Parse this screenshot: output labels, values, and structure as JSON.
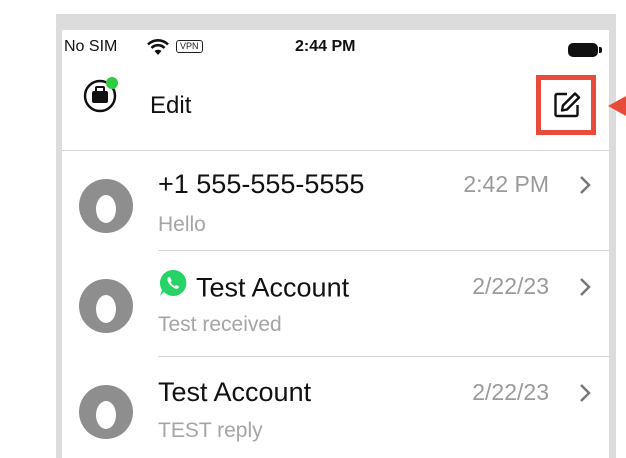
{
  "status_bar": {
    "carrier": "No SIM",
    "vpn": "VPN",
    "time": "2:44 PM"
  },
  "nav": {
    "edit_label": "Edit"
  },
  "conversations": [
    {
      "name": "+1 555-555-5555",
      "preview": "Hello",
      "time": "2:42 PM",
      "has_whatsapp_icon": false
    },
    {
      "name": "Test Account",
      "preview": "Test received",
      "time": "2/22/23",
      "has_whatsapp_icon": true
    },
    {
      "name": "Test Account",
      "preview": "TEST reply",
      "time": "2/22/23",
      "has_whatsapp_icon": false
    }
  ],
  "colors": {
    "highlight": "#e84b3a",
    "whatsapp": "#25d366",
    "presence_dot": "#2ecc40"
  },
  "icons": [
    "wifi-icon",
    "battery-icon",
    "briefcase-icon",
    "compose-icon",
    "chevron-right-icon",
    "whatsapp-icon",
    "person-avatar-icon"
  ]
}
